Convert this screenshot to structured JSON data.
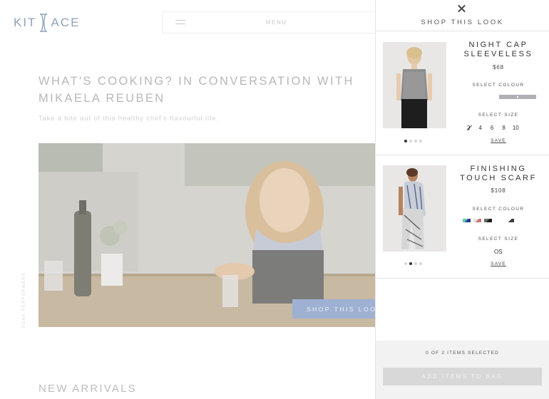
{
  "header": {
    "logo_text_left": "KIT",
    "logo_text_right": "ACE",
    "menu_label": "MENU"
  },
  "article": {
    "title_line1": "WHAT'S COOKING? IN CONVERSATION WITH",
    "title_line2": "MIKAELA REUBEN",
    "subtitle": "Take a bite out of this healthy chef's flavourful life.",
    "shop_button": "SHOP THIS LOOK",
    "side_label": "PEAK PERFORMERS",
    "section_title": "NEW ARRIVALS"
  },
  "panel": {
    "title": "SHOP THIS LOOK",
    "products": [
      {
        "name_line1": "NIGHT CAP",
        "name_line2": "SLEEVELESS",
        "price": "$68",
        "colour_label": "SELECT COLOUR",
        "colours": [
          "#aeb0b6"
        ],
        "size_label": "SELECT SIZE",
        "sizes": [
          "2",
          "4",
          "6",
          "8",
          "10"
        ],
        "unavailable_sizes": [
          "2"
        ],
        "save_label": "SAVE",
        "image_dots": 4,
        "active_dot": 1
      },
      {
        "name_line1": "FINISHING",
        "name_line2": "TOUCH SCARF",
        "price": "$108",
        "colour_label": "SELECT COLOUR",
        "colours": [
          "#5fc7b0",
          "#2c3a8f",
          "#e4e4e4",
          "#c97474",
          "#6a6a6a",
          "#1d1d1d",
          "#ffffff",
          "#3b3b3b"
        ],
        "size_label": "SELECT SIZE",
        "sizes": [
          "OS"
        ],
        "save_label": "SAVE",
        "image_dots": 4,
        "active_dot": 2
      }
    ],
    "items_selected": "0 OF 2 ITEMS SELECTED",
    "add_button": "ADD ITEMS TO BAG"
  },
  "colors": {
    "accent_button": "#9fb1d3",
    "panel_footer": "#f2f2f2"
  }
}
